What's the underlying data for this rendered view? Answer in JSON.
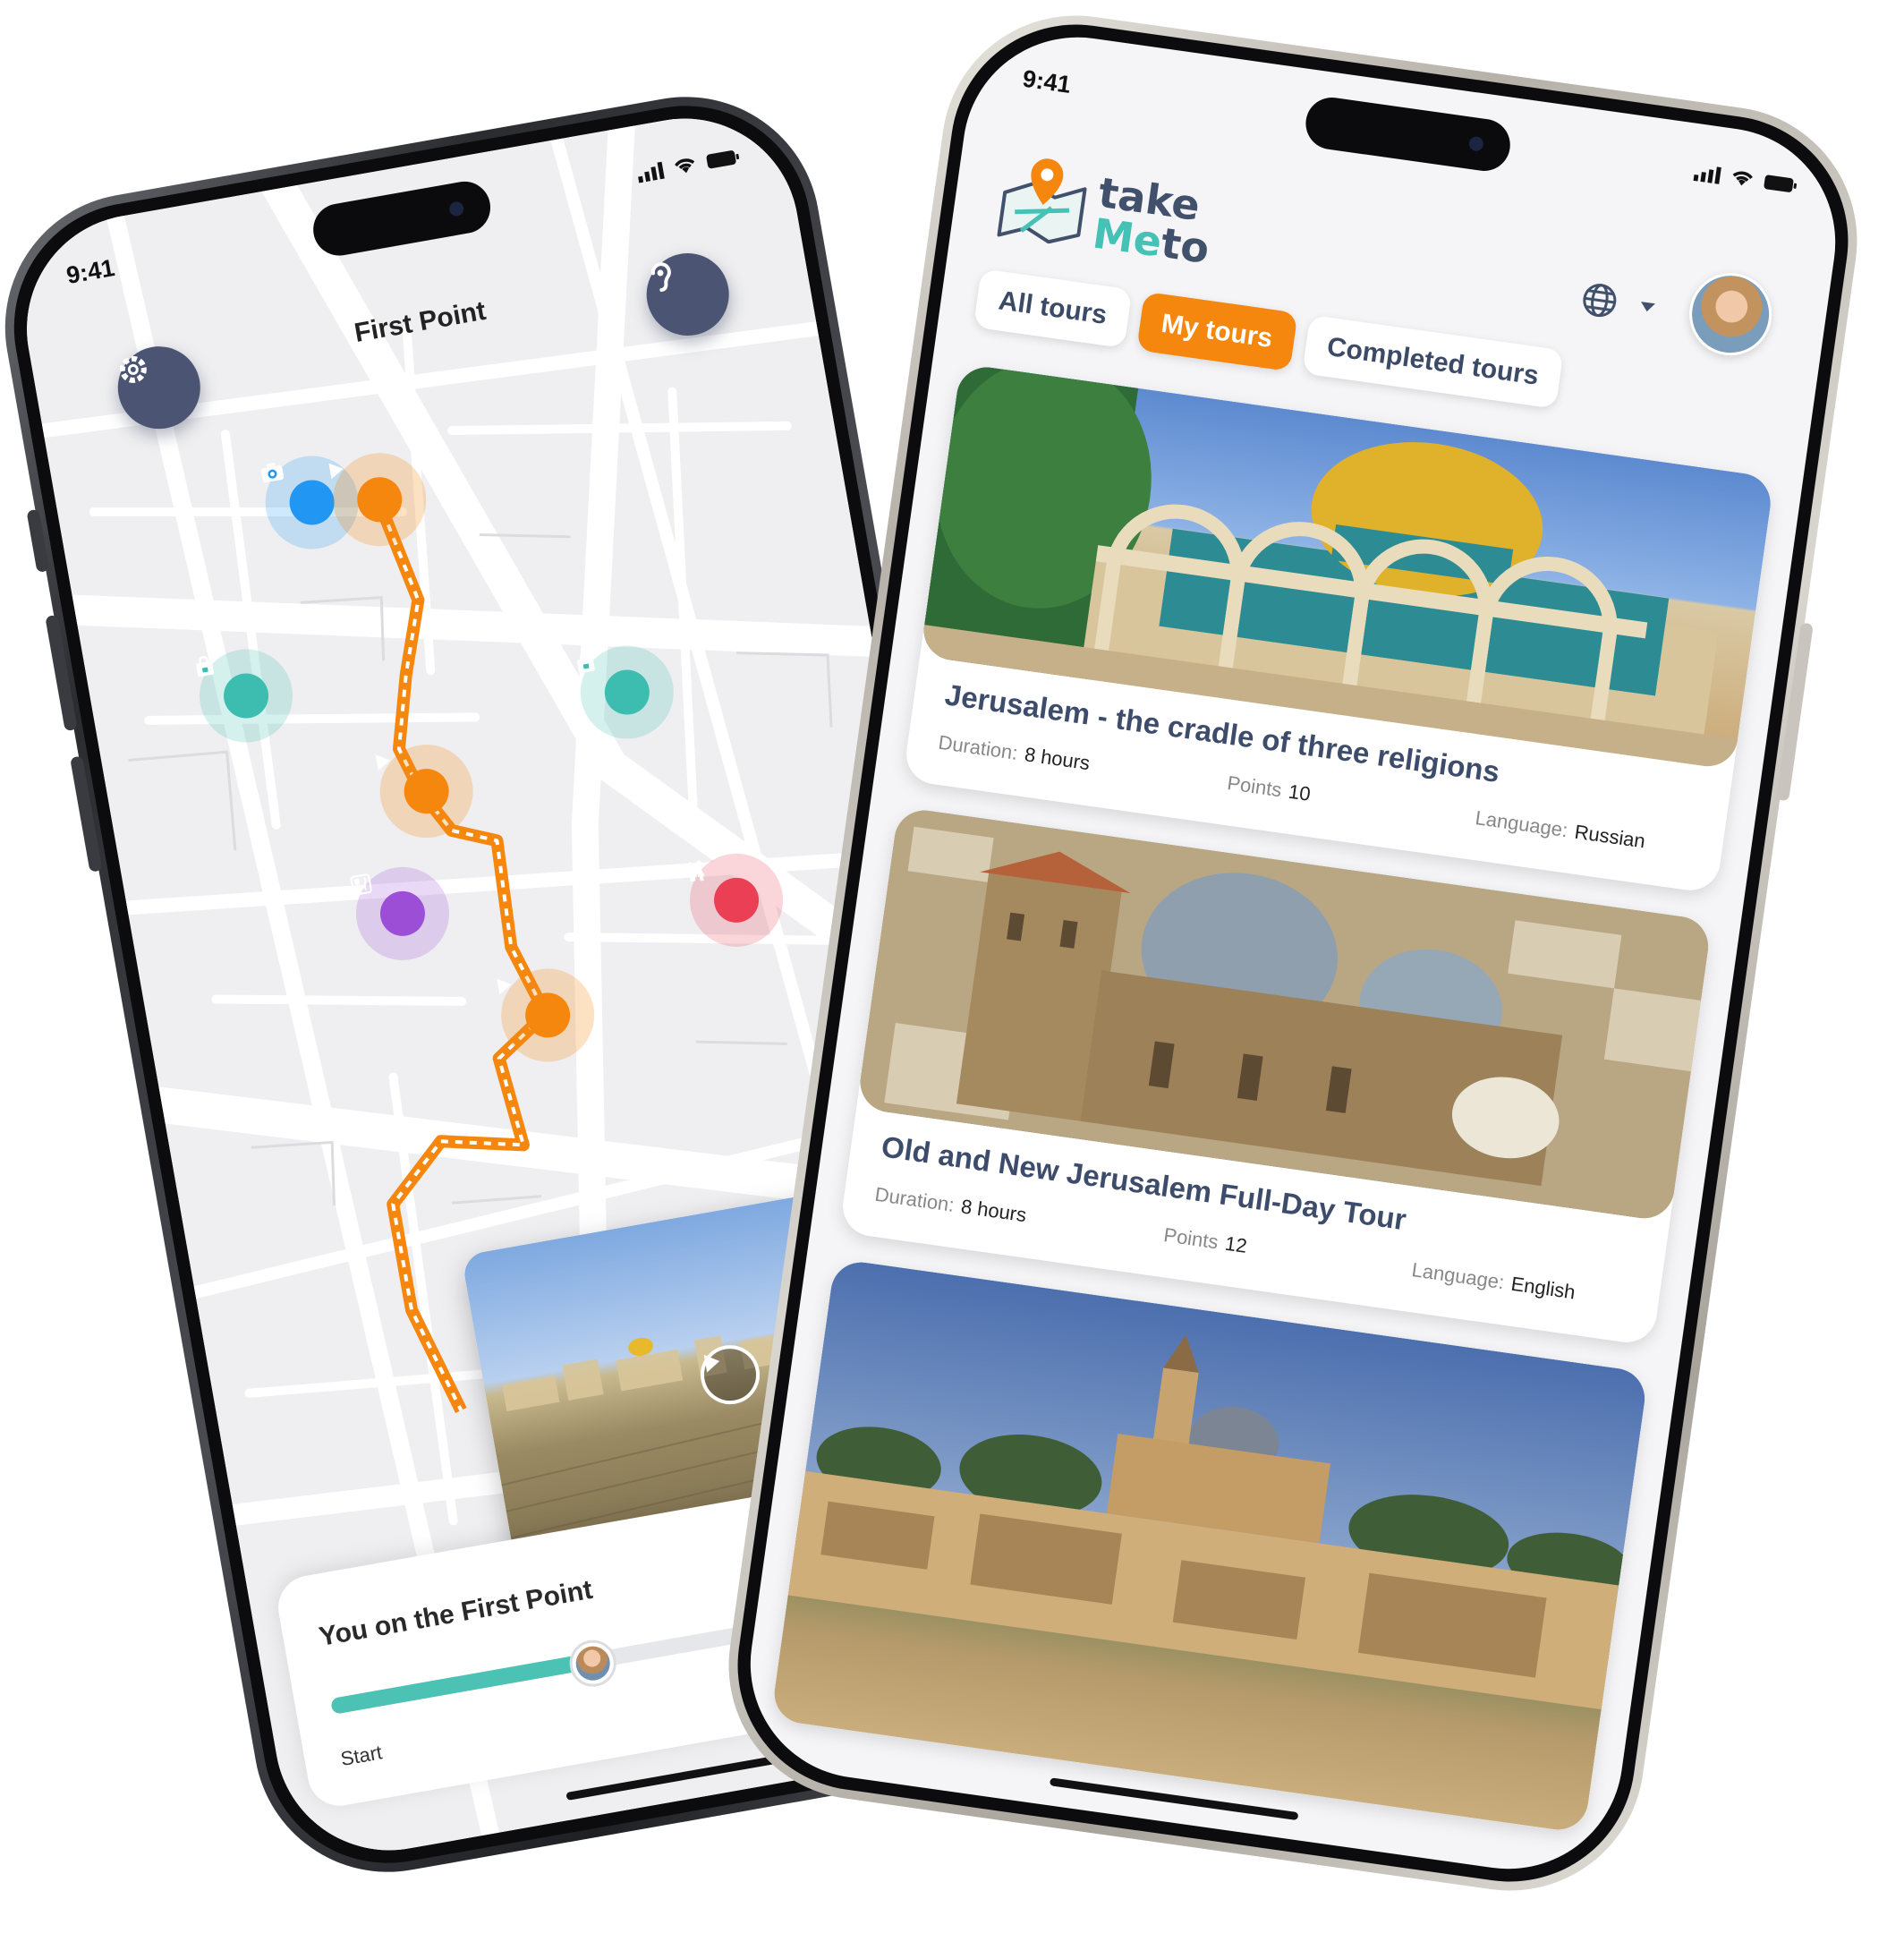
{
  "status_bar": {
    "time": "9:41"
  },
  "map_screen": {
    "title": "First Point",
    "settings_icon": "gear-icon",
    "audio_guide_icon": "ear-icon",
    "pois": [
      {
        "type": "photo",
        "icon": "camera-icon",
        "color": "#2196f3"
      },
      {
        "type": "shop",
        "icon": "shopping-bag-icon",
        "color": "#3cbdb0"
      },
      {
        "type": "shop",
        "icon": "shopping-bag-icon",
        "color": "#3cbdb0"
      },
      {
        "type": "food",
        "icon": "restaurant-icon",
        "color": "#9c4fd6"
      },
      {
        "type": "restroom",
        "icon": "restroom-icon",
        "color": "#ea3f54"
      },
      {
        "type": "stop",
        "icon": "play-icon",
        "color": "#f5870f"
      },
      {
        "type": "stop",
        "icon": "play-icon",
        "color": "#f5870f"
      },
      {
        "type": "stop",
        "icon": "play-icon",
        "color": "#f5870f"
      }
    ],
    "bottom_sheet": {
      "title": "You on the First Point",
      "start_label": "Start",
      "progress": 0.4
    }
  },
  "tours_screen": {
    "logo": {
      "take": "take",
      "me": "Me",
      "to": "to"
    },
    "language_icon": "globe-icon",
    "tabs": [
      {
        "label": "All tours",
        "active": false
      },
      {
        "label": "My tours",
        "active": true
      },
      {
        "label": "Completed tours",
        "active": false
      }
    ],
    "labels": {
      "duration": "Duration:",
      "points": "Points",
      "language": "Language:"
    },
    "tours": [
      {
        "title": "Jerusalem - the cradle of three religions",
        "duration": "8 hours",
        "points": "10",
        "language": "Russian"
      },
      {
        "title": "Old and New Jerusalem Full-Day Tour",
        "duration": "8 hours",
        "points": "12",
        "language": "English"
      }
    ],
    "colors": {
      "accent": "#f5870f",
      "navy": "#3d4c6b",
      "teal": "#46c1b6"
    }
  }
}
